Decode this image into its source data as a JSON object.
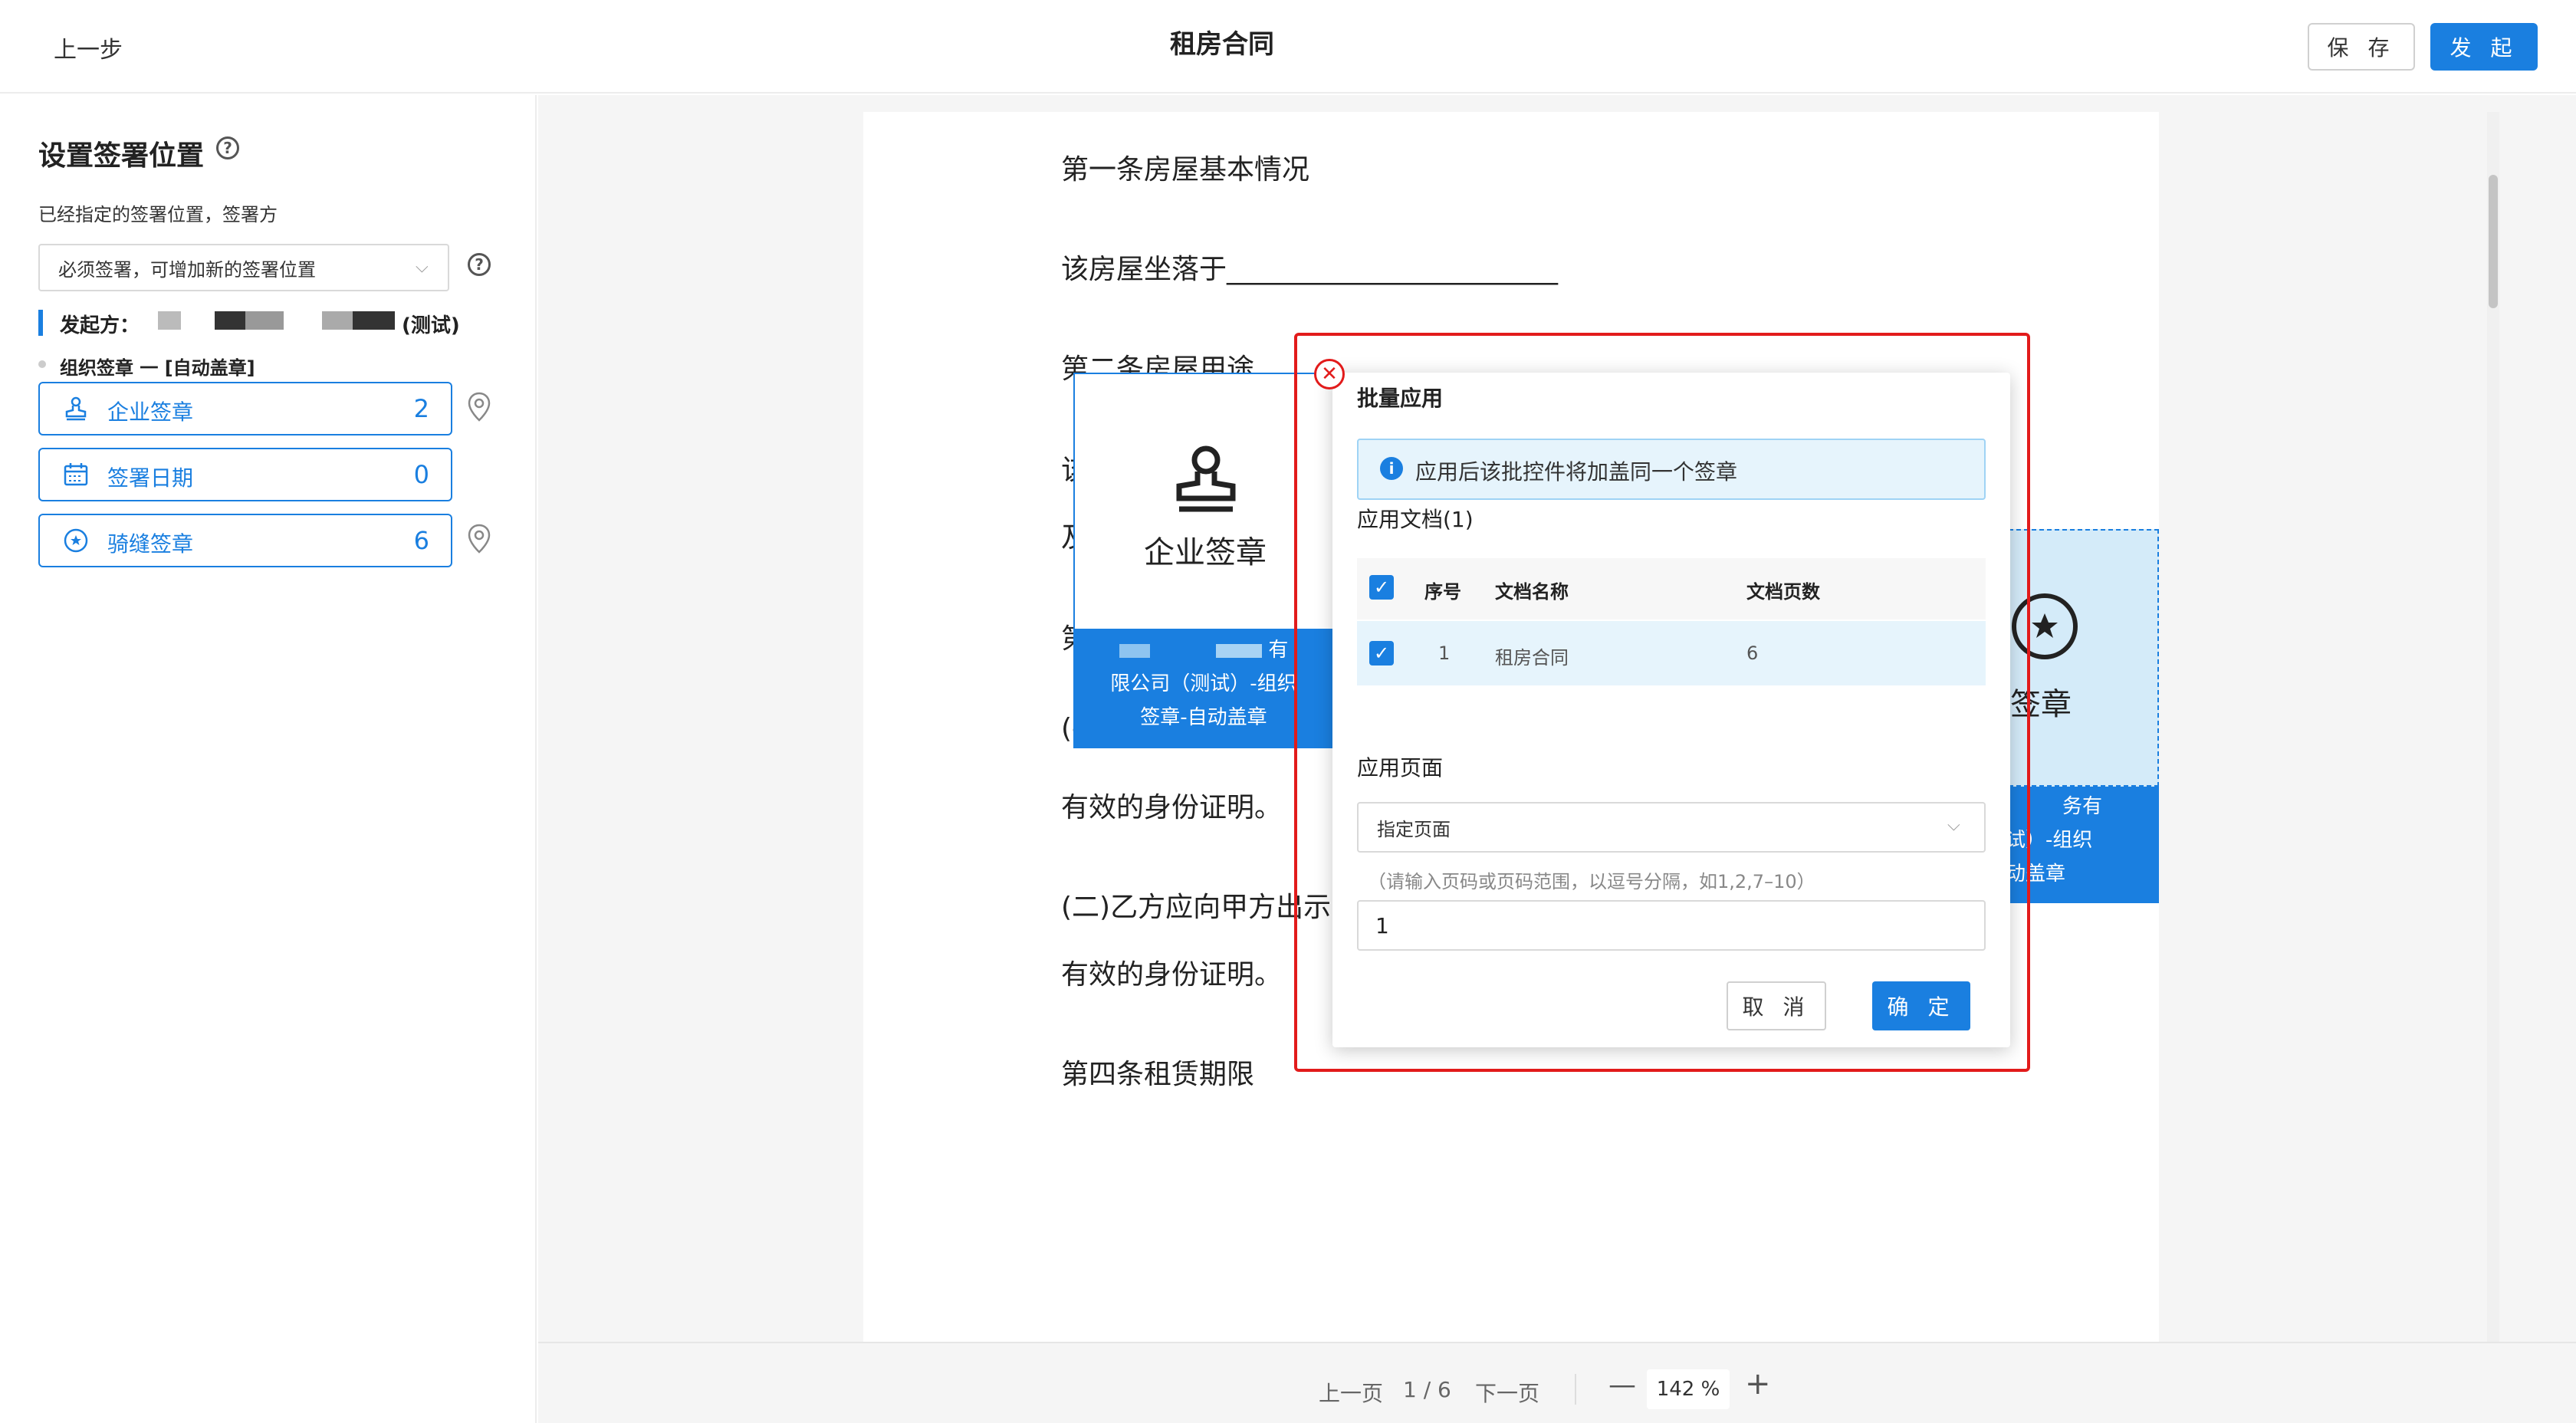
{
  "header": {
    "back_label": "上一步",
    "title": "租房合同",
    "save_label": "保 存",
    "send_label": "发 起"
  },
  "sidebar": {
    "title": "设置签署位置",
    "subtitle": "已经指定的签署位置，签署方",
    "rule_select": "必须签署，可增加新的签署位置",
    "sender_label": "发起方：",
    "sender_suffix": "(测试)",
    "group_label": "组织签章 一 [自动盖章]",
    "items": [
      {
        "label": "企业签章",
        "count": "2",
        "icon": "stamp-icon",
        "has_location": true
      },
      {
        "label": "签署日期",
        "count": "0",
        "icon": "calendar-icon",
        "has_location": false
      },
      {
        "label": "骑缝签章",
        "count": "6",
        "icon": "seal-circle-icon",
        "has_location": true
      }
    ]
  },
  "document": {
    "lines": [
      "第一条房屋基本情况",
      "该房屋坐落于________________________",
      "第二条房屋用途",
      "该",
      "及",
      "第",
      "(-",
      "有效的身份证明。",
      "(二)乙方应向甲方出示",
      "有效的身份证明。",
      "第四条租赁期限"
    ],
    "seal_widget": {
      "label": "企业签章",
      "caption_1": "有",
      "caption_2": "限公司（测试）-组织",
      "caption_3": "签章-自动盖章"
    },
    "ride_widget": {
      "label": "缝签章",
      "caption_1": "务有",
      "caption_2": "测试）-组织",
      "caption_3": "自动盖章"
    }
  },
  "dialog": {
    "title": "批量应用",
    "info": "应用后该批控件将加盖同一个签章",
    "docs_label": "应用文档(1)",
    "columns": [
      "序号",
      "文档名称",
      "文档页数"
    ],
    "rows": [
      {
        "index": "1",
        "name": "租房合同",
        "pages": "6"
      }
    ],
    "pages_label": "应用页面",
    "page_select": "指定页面",
    "hint": "（请输入页码或页码范围，以逗号分隔，如1,2,7–10）",
    "page_input": "1",
    "cancel_label": "取 消",
    "ok_label": "确 定"
  },
  "toolbar": {
    "prev_label": "上一页",
    "page_indicator": "1 / 6",
    "next_label": "下一页",
    "zoom_out": "—",
    "zoom_value": "142 %",
    "zoom_in": "+"
  },
  "colors": {
    "primary": "#1a7fe0",
    "annotation": "#e21b1b",
    "info_bg": "#e6f4fc"
  }
}
